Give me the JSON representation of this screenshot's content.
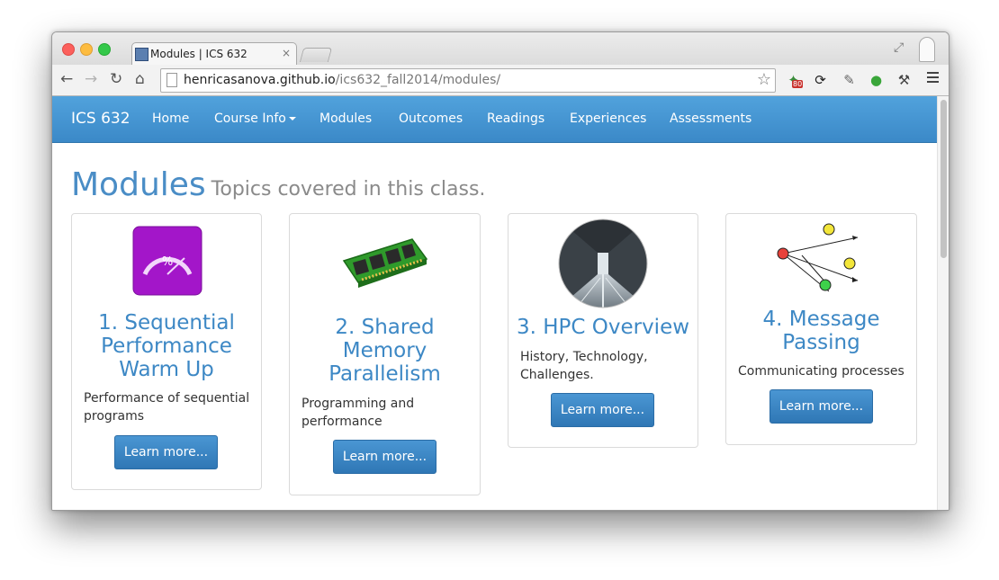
{
  "browser": {
    "tab_title": "Modules | ICS 632",
    "tab_close": "×",
    "url_host": "henricasanova.github.io",
    "url_path": "/ics632_fall2014/modules/",
    "badge_count": "80",
    "star_glyph": "☆",
    "back_glyph": "←",
    "forward_glyph": "→",
    "reload_glyph": "↻",
    "home_glyph": "⌂"
  },
  "navbar": {
    "brand": "ICS 632",
    "items": [
      {
        "label": "Home"
      },
      {
        "label": "Course Info"
      },
      {
        "label": "Modules"
      },
      {
        "label": "Outcomes"
      },
      {
        "label": "Readings"
      },
      {
        "label": "Experiences"
      },
      {
        "label": "Assessments"
      }
    ],
    "color": "#4796d2"
  },
  "header": {
    "title": "Modules",
    "subtitle": "Topics covered in this class."
  },
  "cards": [
    {
      "title_lines": [
        "1. Sequential",
        "Performance",
        "Warm Up"
      ],
      "desc": "Performance of sequential programs",
      "button": "Learn more...",
      "icon": "gauge-icon",
      "gauge_text": "%"
    },
    {
      "title_lines": [
        "2. Shared",
        "Memory",
        "Parallelism"
      ],
      "desc": "Programming and performance",
      "button": "Learn more...",
      "icon": "memory-module-icon"
    },
    {
      "title_lines": [
        "3. HPC Overview"
      ],
      "desc": "History, Technology, Challenges.",
      "button": "Learn more...",
      "icon": "datacenter-aisle-icon"
    },
    {
      "title_lines": [
        "4. Message",
        "Passing"
      ],
      "desc": "Communicating processes",
      "button": "Learn more...",
      "icon": "message-graph-icon"
    }
  ]
}
